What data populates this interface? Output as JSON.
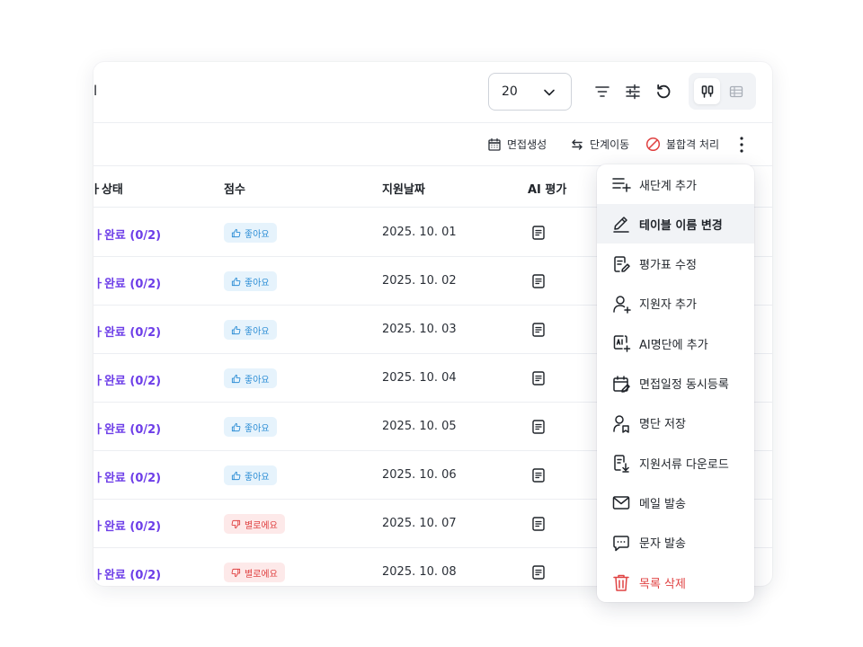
{
  "toolbar": {
    "left_fragment": "l",
    "page_size": "20",
    "icons": [
      "filter-icon",
      "sliders-icon",
      "refresh-icon",
      "kanban-view-icon",
      "table-view-icon"
    ]
  },
  "actions": {
    "create_interview": "면접생성",
    "move_stage": "단계이동",
    "reject": "불합격 처리"
  },
  "table": {
    "headers": [
      "상태",
      "점수",
      "지원날짜",
      "AI 평가"
    ],
    "header_status_fragment": "ㅏ상태",
    "rows": [
      {
        "status": "ㅏ완료 (0/2)",
        "score": "좋아요",
        "score_type": "good",
        "date": "2025. 10. 01"
      },
      {
        "status": "ㅏ완료 (0/2)",
        "score": "좋아요",
        "score_type": "good",
        "date": "2025. 10. 02"
      },
      {
        "status": "ㅏ완료 (0/2)",
        "score": "좋아요",
        "score_type": "good",
        "date": "2025. 10. 03"
      },
      {
        "status": "ㅏ완료 (0/2)",
        "score": "좋아요",
        "score_type": "good",
        "date": "2025. 10. 04"
      },
      {
        "status": "ㅏ완료 (0/2)",
        "score": "좋아요",
        "score_type": "good",
        "date": "2025. 10. 05"
      },
      {
        "status": "ㅏ완료 (0/2)",
        "score": "좋아요",
        "score_type": "good",
        "date": "2025. 10. 06"
      },
      {
        "status": "ㅏ완료 (0/2)",
        "score": "별로에요",
        "score_type": "bad",
        "date": "2025. 10. 07"
      },
      {
        "status": "ㅏ완료 (0/2)",
        "score": "별로에요",
        "score_type": "bad",
        "date": "2025. 10. 08"
      }
    ]
  },
  "menu": {
    "items": [
      {
        "label": "새단계 추가",
        "icon": "add-stage-icon"
      },
      {
        "label": "테이블 이름 변경",
        "icon": "pencil-icon",
        "highlight": true
      },
      {
        "label": "평가표 수정",
        "icon": "edit-document-icon"
      },
      {
        "label": "지원자 추가",
        "icon": "add-user-icon"
      },
      {
        "label": "AI명단에 추가",
        "icon": "ai-add-icon"
      },
      {
        "label": "면접일정 동시등록",
        "icon": "calendar-edit-icon"
      },
      {
        "label": "명단 저장",
        "icon": "user-bookmark-icon"
      },
      {
        "label": "지원서류 다운로드",
        "icon": "document-download-icon"
      },
      {
        "label": "메일 발송",
        "icon": "mail-icon"
      },
      {
        "label": "문자 발송",
        "icon": "chat-icon"
      },
      {
        "label": "목록 삭제",
        "icon": "trash-icon",
        "danger": true
      }
    ]
  },
  "colors": {
    "status_purple": "#6d3ee8",
    "good_badge_bg": "#e6f3fc",
    "good_badge_text": "#2f8fd6",
    "bad_badge_bg": "#fde9e9",
    "bad_badge_text": "#e04343",
    "danger": "#e04343"
  }
}
